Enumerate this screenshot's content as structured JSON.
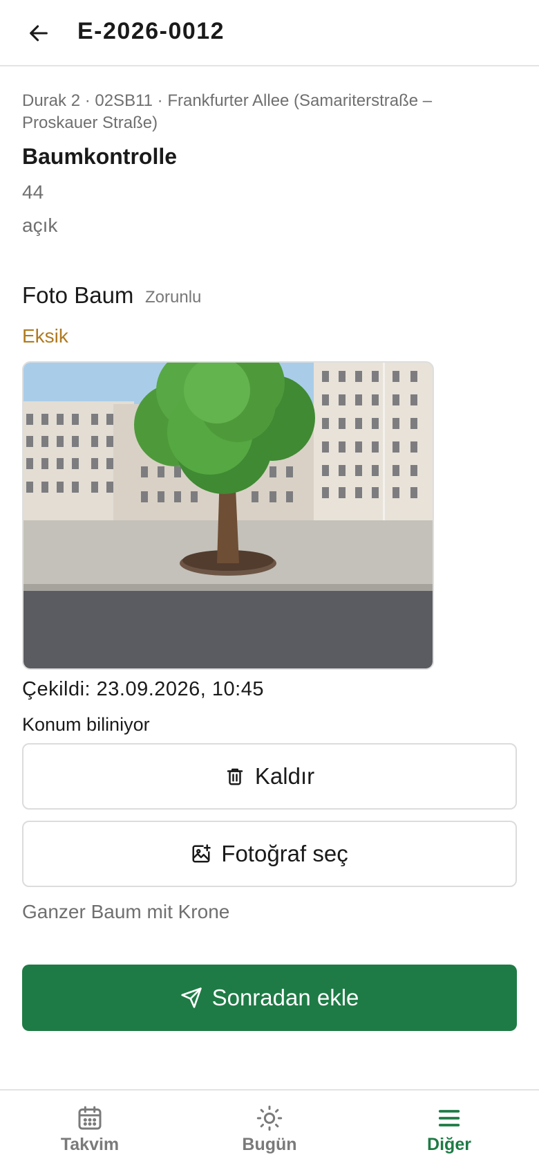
{
  "header": {
    "title": "E-2026-0012"
  },
  "task": {
    "meta": "Durak 2 · 02SB11 · Frankfurter Allee (Samariterstraße – Proskauer Straße)",
    "title": "Baumkontrolle",
    "number": "44",
    "status": "açık"
  },
  "field": {
    "label": "Foto Baum",
    "required": "Zorunlu",
    "state": "Eksik",
    "taken": "Çekildi: 23.09.2026, 10:45",
    "location": "Konum biliniyor",
    "remove_label": "Kaldır",
    "pick_label": "Fotoğraf seç",
    "hint": "Ganzer Baum mit Krone"
  },
  "submit": {
    "label": "Sonradan ekle"
  },
  "nav": {
    "items": [
      {
        "label": "Takvim",
        "icon": "calendar-icon"
      },
      {
        "label": "Bugün",
        "icon": "sun-icon"
      },
      {
        "label": "Diğer",
        "icon": "menu-icon"
      }
    ],
    "active": "Diğer"
  },
  "colors": {
    "accent": "#1e7b45",
    "warning": "#b07a1f",
    "muted": "#6f6f6f"
  }
}
